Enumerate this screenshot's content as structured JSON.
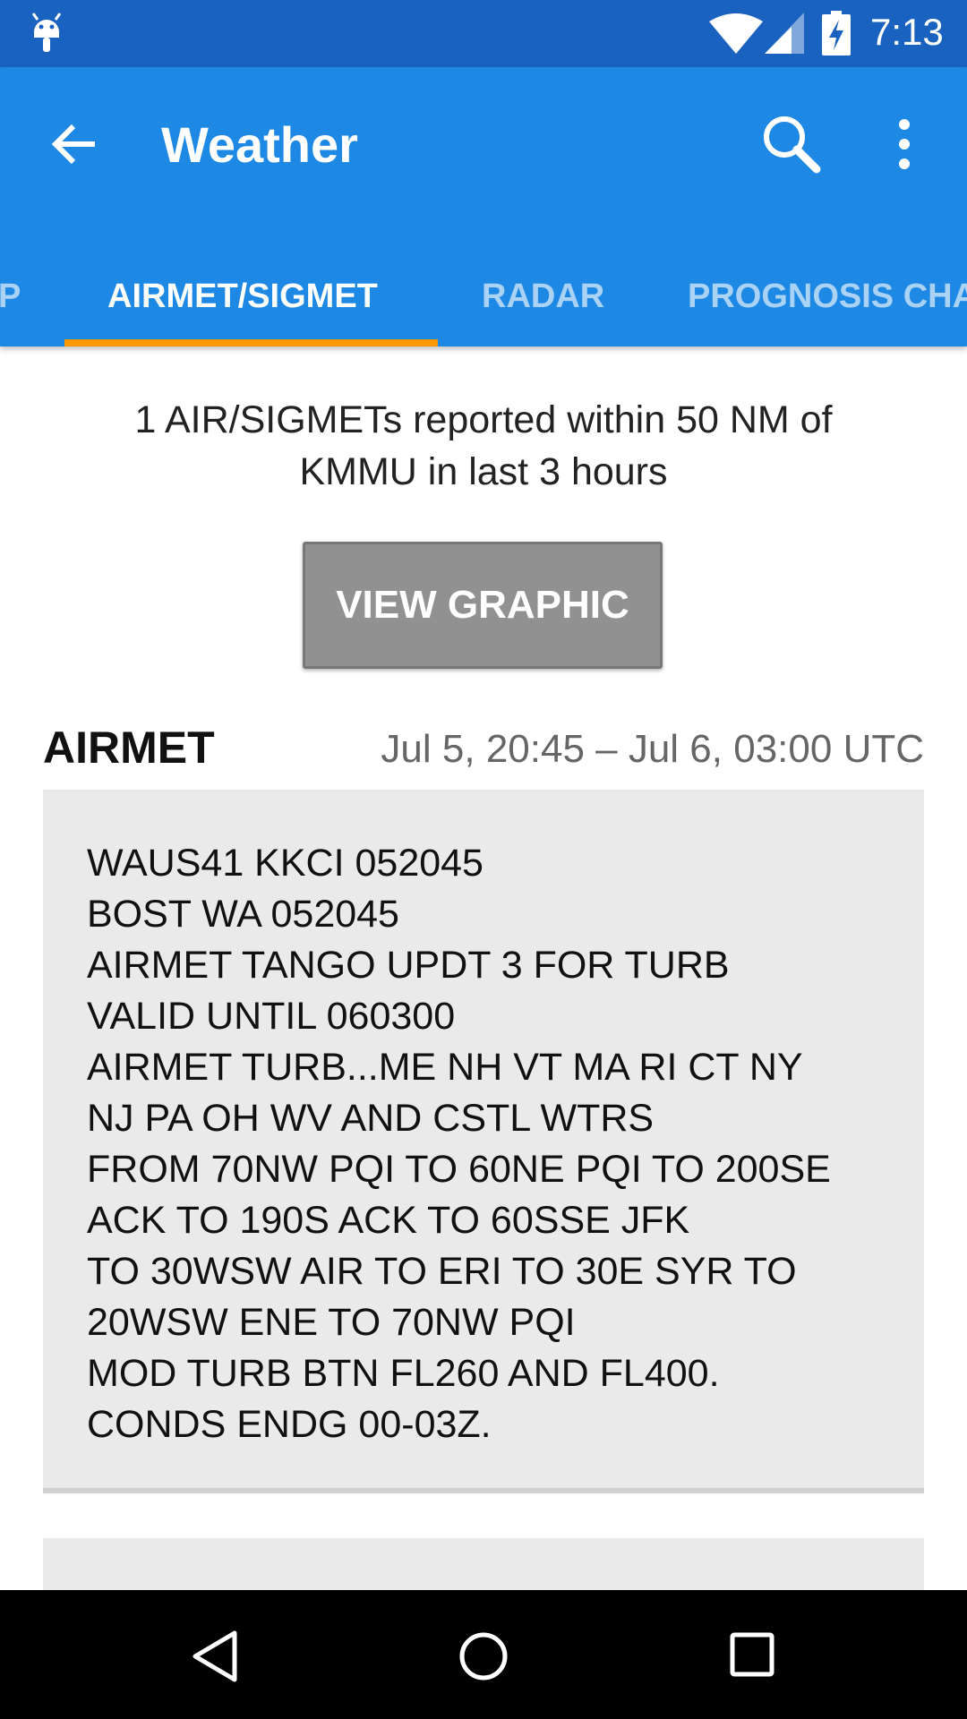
{
  "status_bar": {
    "time": "7:13",
    "icons": [
      "android-icon",
      "wifi-icon",
      "signal-icon",
      "battery-charging-icon"
    ]
  },
  "app_bar": {
    "title": "Weather",
    "back_icon": "arrow-back-icon",
    "search_icon": "search-icon",
    "menu_icon": "more-vert-icon"
  },
  "tabs": [
    {
      "label": "P"
    },
    {
      "label": "AIRMET/SIGMET",
      "active": true
    },
    {
      "label": "RADAR"
    },
    {
      "label": "PROGNOSIS CHA"
    }
  ],
  "summary": {
    "line1": "1 AIR/SIGMETs reported within 50 NM of",
    "line2": "KMMU in last 3 hours"
  },
  "view_graphic_button": "VIEW GRAPHIC",
  "report": {
    "type": "AIRMET",
    "time_range": "Jul 5, 20:45 – Jul 6, 03:00 UTC",
    "lines": [
      "WAUS41 KKCI 052045",
      "BOST WA 052045",
      "AIRMET TANGO UPDT 3 FOR TURB",
      "VALID UNTIL 060300",
      "AIRMET TURB...ME NH VT MA RI CT NY",
      "NJ PA OH WV AND CSTL WTRS",
      "FROM 70NW PQI TO 60NE PQI TO 200SE",
      "ACK TO 190S ACK TO 60SSE JFK",
      "TO 30WSW AIR TO ERI TO 30E SYR TO",
      "20WSW ENE TO 70NW PQI",
      "MOD TURB BTN FL260 AND FL400.",
      "CONDS ENDG 00-03Z."
    ]
  },
  "colors": {
    "status_bar": "#1a62c0",
    "app_bar": "#1e88e5",
    "tab_indicator": "#ff9800",
    "card_bg": "#eaeaea",
    "button_bg": "#919191"
  }
}
